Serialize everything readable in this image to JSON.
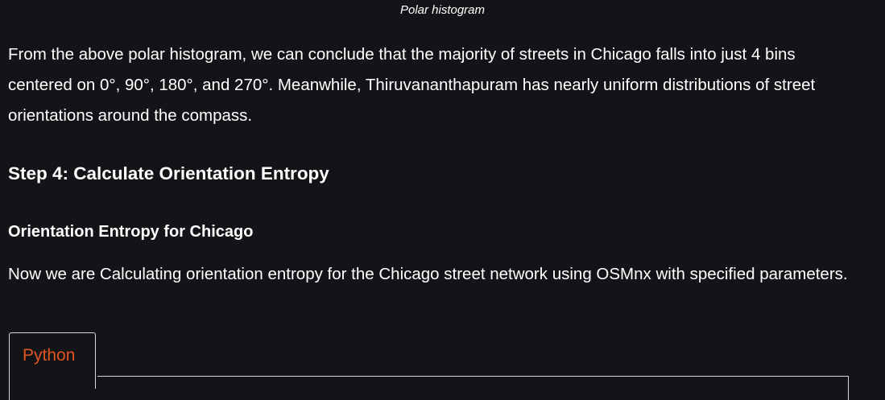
{
  "figure": {
    "caption": "Polar histogram"
  },
  "paragraphs": {
    "conclusion": "From the above polar histogram, we can conclude that the majority of streets in Chicago falls into just 4 bins centered on 0°, 90°, 180°, and 270°. Meanwhile, Thiruvananthapuram has nearly uniform distributions of street orientations around the compass.",
    "intro": "Now we are Calculating orientation entropy for the Chicago street network using OSMnx with specified parameters."
  },
  "headings": {
    "step": "Step 4: Calculate Orientation Entropy",
    "subsection": "Orientation Entropy for Chicago"
  },
  "code_tabs": {
    "active_tab": "Python"
  },
  "colors": {
    "background": "#131417",
    "text": "#ffffff",
    "tab_accent": "#e2541f",
    "tab_border": "#d8d8d8"
  }
}
